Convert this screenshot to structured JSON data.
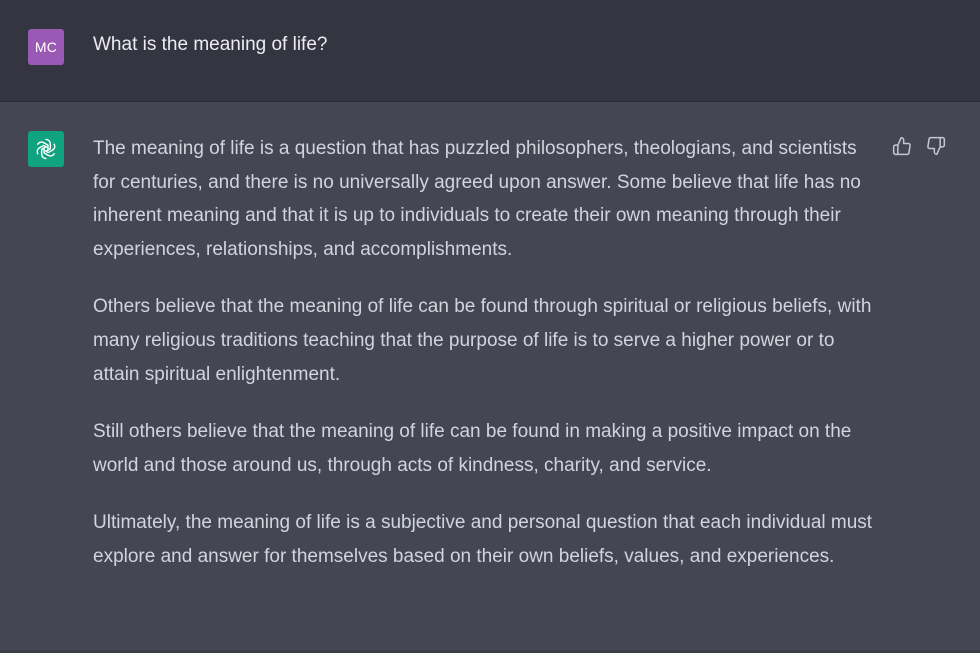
{
  "user": {
    "initials": "MC",
    "message": "What is the meaning of life?"
  },
  "assistant": {
    "paragraphs": [
      "The meaning of life is a question that has puzzled philosophers, theologians, and scientists for centuries, and there is no universally agreed upon answer. Some believe that life has no inherent meaning and that it is up to individuals to create their own meaning through their experiences, relationships, and accomplishments.",
      "Others believe that the meaning of life can be found through spiritual or religious beliefs, with many religious traditions teaching that the purpose of life is to serve a higher power or to attain spiritual enlightenment.",
      "Still others believe that the meaning of life can be found in making a positive impact on the world and those around us, through acts of kindness, charity, and service.",
      "Ultimately, the meaning of life is a subjective and personal question that each individual must explore and answer for themselves based on their own beliefs, values, and experiences."
    ]
  },
  "icons": {
    "bot": "openai-logo-icon",
    "like": "thumbs-up-icon",
    "dislike": "thumbs-down-icon"
  },
  "colors": {
    "user_row_bg": "#343541",
    "assistant_row_bg": "#444654",
    "user_avatar_bg": "#9b59b6",
    "bot_avatar_bg": "#10a37f"
  }
}
